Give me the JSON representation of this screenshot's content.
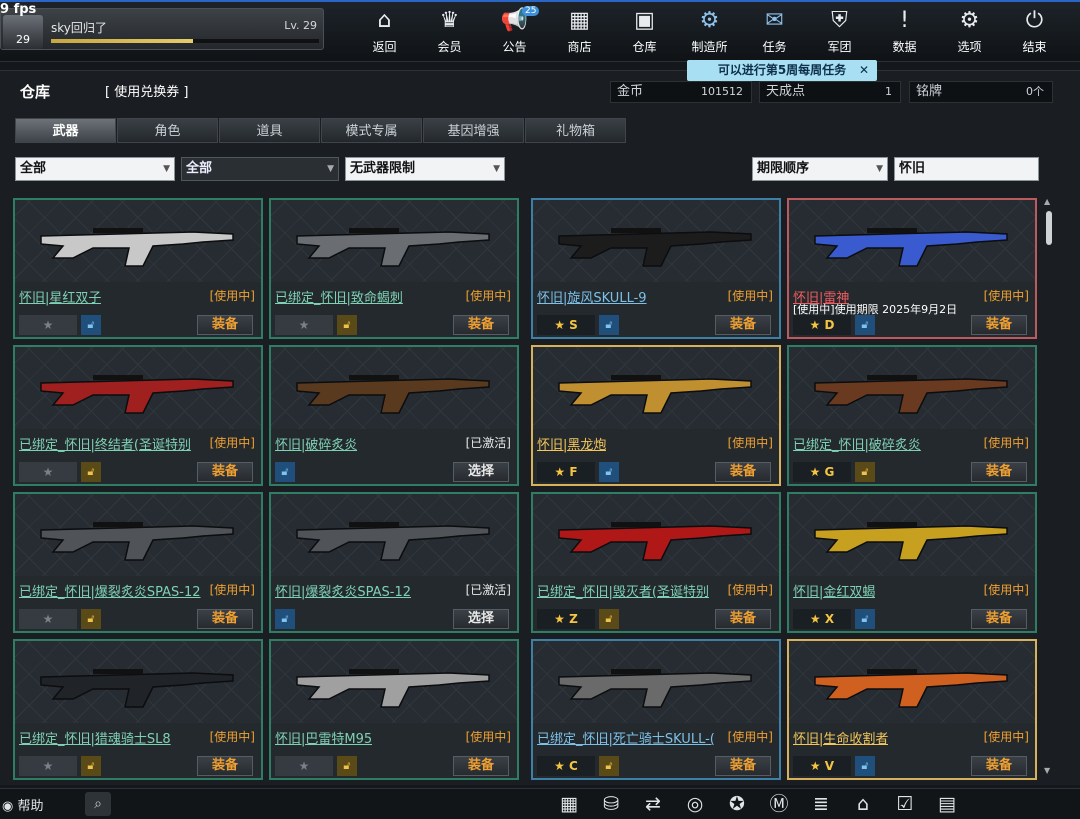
{
  "fps": "9 fps",
  "player": {
    "name": "sky回归了",
    "level": "Lv. 29",
    "rank": "29",
    "exp_fraction": 0.53
  },
  "nav": [
    {
      "label": "返回",
      "icon": "home-icon",
      "glyph": "⌂"
    },
    {
      "label": "会员",
      "icon": "crown-icon",
      "glyph": "♛"
    },
    {
      "label": "公告",
      "icon": "megaphone-icon",
      "glyph": "📢",
      "badge": "25"
    },
    {
      "label": "商店",
      "icon": "shop-icon",
      "glyph": "▦"
    },
    {
      "label": "仓库",
      "icon": "briefcase-icon",
      "glyph": "▣"
    },
    {
      "label": "制造所",
      "icon": "factory-icon",
      "glyph": "⚙"
    },
    {
      "label": "任务",
      "icon": "ticket-icon",
      "glyph": "✉"
    },
    {
      "label": "军团",
      "icon": "clan-shield-icon",
      "glyph": "⛨"
    },
    {
      "label": "数据",
      "icon": "alert-icon",
      "glyph": "!"
    },
    {
      "label": "选项",
      "icon": "gear-icon",
      "glyph": "⚙"
    },
    {
      "label": "结束",
      "icon": "power-icon",
      "glyph": "⏻"
    }
  ],
  "quest_tip": "可以进行第5周每周任务",
  "inventory": {
    "title": "仓库",
    "voucher": "[ 使用兑换券 ]",
    "gold_label": "金币",
    "gold_value": "101512",
    "points_label": "天成点",
    "points_value": "1",
    "badge_label": "铭牌",
    "badge_value": "0个"
  },
  "tabs": [
    "武器",
    "角色",
    "道具",
    "模式专属",
    "基因增强",
    "礼物箱"
  ],
  "filters": {
    "f1": "全部",
    "f2": "全部",
    "f3": "无武器限制",
    "sort": "期限顺序",
    "search": "怀旧"
  },
  "items": [
    {
      "name": "怀旧|星红双子",
      "status": "[使用中]",
      "star": "★",
      "btn": "装备",
      "style": "green",
      "lock": "blue",
      "starOn": false
    },
    {
      "name": "已绑定_怀旧|致命蝎刺",
      "status": "[使用中]",
      "star": "★",
      "btn": "装备",
      "style": "green",
      "lock": "gold",
      "starOn": false
    },
    {
      "name": "怀旧|旋风SKULL-9",
      "status": "[使用中]",
      "star": "★ S",
      "btn": "装备",
      "style": "blue",
      "lock": "blue",
      "starOn": true
    },
    {
      "name": "怀旧|雷神",
      "status": "[使用中]",
      "period": "[使用中]使用期限 2025年9月2日",
      "star": "★ D",
      "btn": "装备",
      "style": "red",
      "lock": "blue",
      "starOn": true
    },
    {
      "name": "已绑定_怀旧|终结者(圣诞特别",
      "status": "[使用中]",
      "star": "★",
      "btn": "装备",
      "style": "green",
      "lock": "gold",
      "starOn": false
    },
    {
      "name": "怀旧|破碎炙炎",
      "status": "[已激活]",
      "star": "",
      "btn": "选择",
      "style": "green",
      "lock": "blue",
      "starOn": false,
      "noStar": true
    },
    {
      "name": "怀旧|黑龙炮",
      "status": "[使用中]",
      "star": "★ F",
      "btn": "装备",
      "style": "gold",
      "lock": "blue",
      "starOn": true
    },
    {
      "name": "已绑定_怀旧|破碎炙炎",
      "status": "[使用中]",
      "star": "★ G",
      "btn": "装备",
      "style": "green",
      "lock": "gold",
      "starOn": true
    },
    {
      "name": "已绑定_怀旧|爆裂炙炎SPAS-12",
      "status": "[使用中]",
      "star": "★",
      "btn": "装备",
      "style": "green",
      "lock": "gold",
      "starOn": false
    },
    {
      "name": "怀旧|爆裂炙炎SPAS-12",
      "status": "[已激活]",
      "star": "",
      "btn": "选择",
      "style": "green",
      "lock": "blue",
      "starOn": false,
      "noStar": true
    },
    {
      "name": "已绑定_怀旧|毁灭者(圣诞特别",
      "status": "[使用中]",
      "star": "★ Z",
      "btn": "装备",
      "style": "green",
      "lock": "gold",
      "starOn": true
    },
    {
      "name": "怀旧|金红双蝎",
      "status": "[使用中]",
      "star": "★ X",
      "btn": "装备",
      "style": "green",
      "lock": "blue",
      "starOn": true
    },
    {
      "name": "已绑定_怀旧|猎魂骑士SL8",
      "status": "[使用中]",
      "star": "★",
      "btn": "装备",
      "style": "green",
      "lock": "gold",
      "starOn": false
    },
    {
      "name": "怀旧|巴雷特M95",
      "status": "[使用中]",
      "star": "★",
      "btn": "装备",
      "style": "green",
      "lock": "gold",
      "starOn": false
    },
    {
      "name": "已绑定_怀旧|死亡骑士SKULL-(",
      "status": "[使用中]",
      "star": "★ C",
      "btn": "装备",
      "style": "blue",
      "lock": "gold",
      "starOn": true
    },
    {
      "name": "怀旧|生命收割者",
      "status": "[使用中]",
      "star": "★ V",
      "btn": "装备",
      "style": "gold",
      "lock": "blue",
      "starOn": true
    }
  ],
  "bottom": {
    "help": "帮助",
    "icons": [
      "calendar-icon",
      "basket-icon",
      "swap-icon",
      "compass-icon",
      "runner-icon",
      "market-icon",
      "checklist-icon",
      "home-icon",
      "clipboard-icon",
      "film-icon"
    ],
    "glyphs": [
      "▦",
      "⛁",
      "⇄",
      "◎",
      "✪",
      "Ⓜ",
      "≣",
      "⌂",
      "☑",
      "▤"
    ]
  }
}
